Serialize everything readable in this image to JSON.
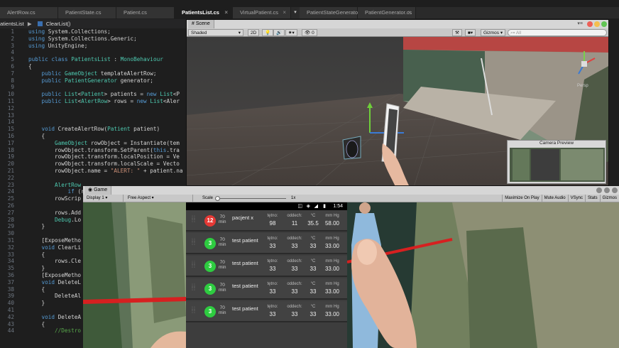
{
  "editor": {
    "tabs": [
      {
        "label": "AlertRow.cs",
        "active": false,
        "closable": false
      },
      {
        "label": "PatientState.cs",
        "active": false,
        "closable": false
      },
      {
        "label": "Patient.cs",
        "active": false,
        "closable": false
      },
      {
        "label": "PatientsList.cs",
        "active": true,
        "closable": true
      },
      {
        "label": "VirtualPatient.cs",
        "active": false,
        "closable": true
      },
      {
        "label": "PatientStateGenerator.cs",
        "active": false,
        "closable": false
      },
      {
        "label": "PatientGenerator.cs",
        "active": false,
        "closable": true
      }
    ],
    "more_tabs_glyph": "▾",
    "breadcrumb_class": "atientsList",
    "breadcrumb_sep": "▶",
    "breadcrumb_method": "ClearList()",
    "lines": [
      {
        "n": "1",
        "code": "using System.Collections;"
      },
      {
        "n": "2",
        "code": "using System.Collections.Generic;"
      },
      {
        "n": "3",
        "code": "using UnityEngine;"
      },
      {
        "n": "4",
        "code": ""
      },
      {
        "n": "5",
        "code": "public class PatientsList : MonoBehaviour"
      },
      {
        "n": "6",
        "code": "{"
      },
      {
        "n": "7",
        "code": "    public GameObject templateAlertRow;"
      },
      {
        "n": "8",
        "code": "    public PatientGenerator generator;"
      },
      {
        "n": "9",
        "code": ""
      },
      {
        "n": "10",
        "code": "    public List<Patient> patients = new List<P"
      },
      {
        "n": "11",
        "code": "    public List<AlertRow> rows = new List<Aler"
      },
      {
        "n": "12",
        "code": ""
      },
      {
        "n": "13",
        "code": ""
      },
      {
        "n": "14",
        "code": ""
      },
      {
        "n": "15",
        "code": "    void CreateAlertRow(Patient patient)"
      },
      {
        "n": "16",
        "code": "    {"
      },
      {
        "n": "17",
        "code": "        GameObject rowObject = Instantiate(tem"
      },
      {
        "n": "18",
        "code": "        rowObject.transform.SetParent(this.tra"
      },
      {
        "n": "19",
        "code": "        rowObject.transform.localPosition = Ve"
      },
      {
        "n": "20",
        "code": "        rowObject.transform.localScale = Vecto"
      },
      {
        "n": "21",
        "code": "        rowObject.name = \"ALERT: \" + patient.na"
      },
      {
        "n": "22",
        "code": ""
      },
      {
        "n": "23",
        "code": "        AlertRow"
      },
      {
        "n": "24",
        "code": "            if (r"
      },
      {
        "n": "25",
        "code": "        rowScrip"
      },
      {
        "n": "26",
        "code": ""
      },
      {
        "n": "27",
        "code": "        rows.Add"
      },
      {
        "n": "28",
        "code": "        Debug.Lo"
      },
      {
        "n": "29",
        "code": "    }"
      },
      {
        "n": "30",
        "code": ""
      },
      {
        "n": "31",
        "code": "    [ExposeMetho"
      },
      {
        "n": "32",
        "code": "    void ClearLi"
      },
      {
        "n": "33",
        "code": "    {"
      },
      {
        "n": "34",
        "code": "        rows.Cle"
      },
      {
        "n": "35",
        "code": "    }"
      },
      {
        "n": "36",
        "code": "    [ExposeMetho"
      },
      {
        "n": "37",
        "code": "    void DeleteL"
      },
      {
        "n": "38",
        "code": "    {"
      },
      {
        "n": "39",
        "code": "        DeleteAl"
      },
      {
        "n": "40",
        "code": "    }"
      },
      {
        "n": "41",
        "code": ""
      },
      {
        "n": "42",
        "code": "    void DeleteA"
      },
      {
        "n": "43",
        "code": "    {"
      },
      {
        "n": "44",
        "code": "        //Destro"
      }
    ]
  },
  "scene": {
    "tab_label": "Scene",
    "shading": "Shaded",
    "mode_2d": "2D",
    "gizmos": "Gizmos",
    "search_placeholder": "All",
    "layers_count": "0",
    "persp_label": "Persp",
    "camera_preview_title": "Camera Preview"
  },
  "game": {
    "tab_label": "Game",
    "display": "Display 1",
    "aspect": "Free Aspect",
    "scale_label": "Scale",
    "scale_value": "1x",
    "toggles": [
      "Maximize On Play",
      "Mute Audio",
      "VSync",
      "Stats",
      "Gizmos"
    ]
  },
  "phone": {
    "time": "1:54",
    "rows": [
      {
        "score": "12",
        "color": "#e53935",
        "min_value": "70",
        "min_unit": "min",
        "name": "pacjent x",
        "hr_label": "tętno:",
        "hr": "98",
        "rr_label": "oddech:",
        "rr": "11",
        "temp_label": "°C",
        "temp": "35.5",
        "bp_label": "mm Hg",
        "bp": "58.00"
      },
      {
        "score": "3",
        "color": "#2ecc40",
        "min_value": "70",
        "min_unit": "min",
        "name": "test patient",
        "hr_label": "tętno:",
        "hr": "33",
        "rr_label": "oddech:",
        "rr": "33",
        "temp_label": "°C",
        "temp": "33",
        "bp_label": "mm Hg",
        "bp": "33.00"
      },
      {
        "score": "3",
        "color": "#2ecc40",
        "min_value": "70",
        "min_unit": "min",
        "name": "test patient",
        "hr_label": "tętno:",
        "hr": "33",
        "rr_label": "oddech:",
        "rr": "33",
        "temp_label": "°C",
        "temp": "33",
        "bp_label": "mm Hg",
        "bp": "33.00"
      },
      {
        "score": "3",
        "color": "#2ecc40",
        "min_value": "70",
        "min_unit": "min",
        "name": "test patient",
        "hr_label": "tętno:",
        "hr": "33",
        "rr_label": "oddech:",
        "rr": "33",
        "temp_label": "°C",
        "temp": "33",
        "bp_label": "mm Hg",
        "bp": "33.00"
      },
      {
        "score": "3",
        "color": "#2ecc40",
        "min_value": "70",
        "min_unit": "min",
        "name": "test patient",
        "hr_label": "tętno:",
        "hr": "33",
        "rr_label": "oddech:",
        "rr": "33",
        "temp_label": "°C",
        "temp": "33",
        "bp_label": "mm Hg",
        "bp": "33.00"
      }
    ]
  }
}
